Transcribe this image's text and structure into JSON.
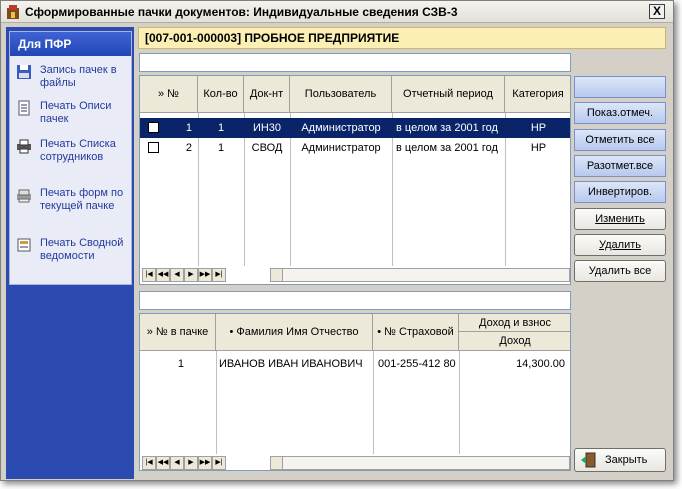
{
  "window": {
    "title": "Сформированные пачки документов: Индивидуальные сведения СЗВ-3",
    "close": "X"
  },
  "sidebar": {
    "header": "Для ПФР",
    "items": [
      {
        "label": "Запись пачек в файлы",
        "icon": "floppy-disk-icon"
      },
      {
        "label": "Печать Описи пачек",
        "icon": "document-list-icon"
      },
      {
        "label": "Печать Списка сотрудников",
        "icon": "printer-icon"
      },
      {
        "label": "Печать форм по текущей пачке",
        "icon": "printer-gray-icon"
      },
      {
        "label": "Печать Сводной ведомости",
        "icon": "summary-sheet-icon"
      }
    ]
  },
  "company": "[007-001-000003] ПРОБНОЕ ПРЕДПРИЯТИЕ",
  "top_grid": {
    "columns": [
      "» №",
      "Кол-во",
      "Док-нт",
      "Пользователь",
      "Отчетный период",
      "Категория"
    ],
    "rows": [
      {
        "num": "1",
        "qty": "1",
        "doc": "ИН30",
        "user": "Администратор",
        "period": "в целом за 2001 год",
        "category": "НР",
        "selected": true
      },
      {
        "num": "2",
        "qty": "1",
        "doc": "СВОД",
        "user": "Администратор",
        "period": "в целом за 2001 год",
        "category": "НР",
        "selected": false
      }
    ]
  },
  "bottom_grid": {
    "columns": [
      "» № в пачке",
      "• Фамилия Имя Отчество",
      "• № Страховой",
      "Доход и взнос"
    ],
    "subcolumn": "Доход",
    "rows": [
      {
        "num": "1",
        "name": "ИВАНОВ ИВАН ИВАНОВИЧ",
        "insurance": "001-255-412 80",
        "income": "14,300.00"
      }
    ]
  },
  "buttons": {
    "show_marked": "Показ.отмеч.",
    "mark_all": "Отметить все",
    "unmark_all": "Разотмет.все",
    "invert": "Инвертиров.",
    "edit": "Изменить",
    "delete": "Удалить",
    "delete_all": "Удалить все",
    "close": "Закрыть"
  },
  "colors": {
    "sidebar_bg": "#2c4bb0",
    "header_bg": "#fbefb4",
    "selected_row": "#0a246a"
  }
}
